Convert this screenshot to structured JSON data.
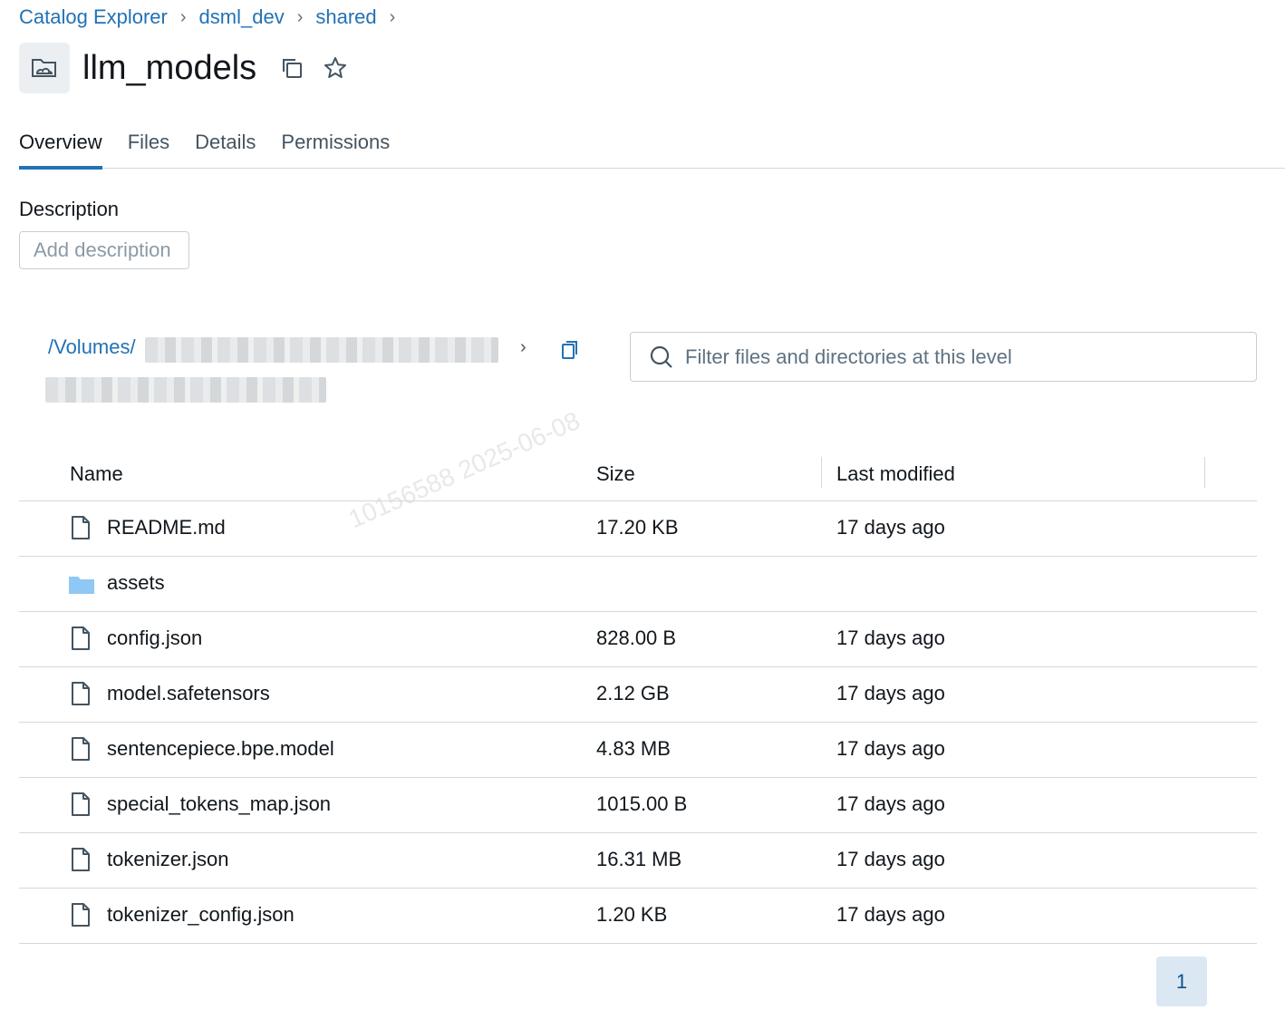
{
  "breadcrumb": [
    {
      "label": "Catalog Explorer"
    },
    {
      "label": "dsml_dev"
    },
    {
      "label": "shared"
    }
  ],
  "breadcrumb_separator": "›",
  "title": "llm_models",
  "icons": {
    "volume": "volume-icon",
    "copy": "copy-icon",
    "star": "star-icon",
    "search": "search-icon",
    "file": "file-icon",
    "folder": "folder-icon",
    "chevron": "chevron-right-icon"
  },
  "tabs": [
    {
      "label": "Overview",
      "active": true
    },
    {
      "label": "Files",
      "active": false
    },
    {
      "label": "Details",
      "active": false
    },
    {
      "label": "Permissions",
      "active": false
    }
  ],
  "description": {
    "label": "Description",
    "button_label": "Add description"
  },
  "path": {
    "root": "/Volumes/",
    "chevron": "›"
  },
  "filter": {
    "placeholder": "Filter files and directories at this level",
    "value": ""
  },
  "watermark": "10156588  2025-06-08",
  "table": {
    "headers": {
      "name": "Name",
      "size": "Size",
      "modified": "Last modified"
    },
    "rows": [
      {
        "type": "file",
        "name": "README.md",
        "size": "17.20 KB",
        "modified": "17 days ago"
      },
      {
        "type": "folder",
        "name": "assets",
        "size": "",
        "modified": ""
      },
      {
        "type": "file",
        "name": "config.json",
        "size": "828.00 B",
        "modified": "17 days ago"
      },
      {
        "type": "file",
        "name": "model.safetensors",
        "size": "2.12 GB",
        "modified": "17 days ago"
      },
      {
        "type": "file",
        "name": "sentencepiece.bpe.model",
        "size": "4.83 MB",
        "modified": "17 days ago"
      },
      {
        "type": "file",
        "name": "special_tokens_map.json",
        "size": "1015.00 B",
        "modified": "17 days ago"
      },
      {
        "type": "file",
        "name": "tokenizer.json",
        "size": "16.31 MB",
        "modified": "17 days ago"
      },
      {
        "type": "file",
        "name": "tokenizer_config.json",
        "size": "1.20 KB",
        "modified": "17 days ago"
      }
    ]
  },
  "pagination": {
    "current_page": "1"
  },
  "colors": {
    "link": "#2272b4",
    "active_tab_underline": "#2272b4",
    "folder": "#8fc7f5",
    "pager_bg": "#dbe7f2"
  }
}
